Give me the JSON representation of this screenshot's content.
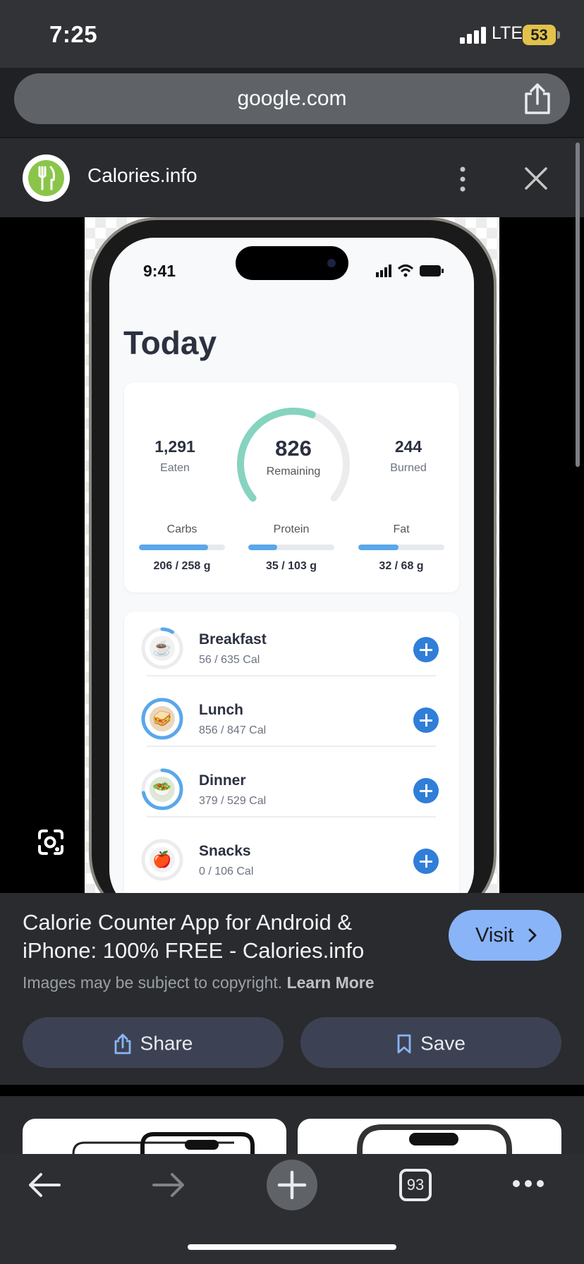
{
  "status_bar": {
    "time": "7:25",
    "network": "LTE",
    "battery": "53"
  },
  "browser": {
    "url": "google.com"
  },
  "site_header": {
    "site_name": "Calories.info"
  },
  "preview": {
    "phone_time": "9:41",
    "page_title": "Today",
    "summary": {
      "eaten": {
        "value": "1,291",
        "label": "Eaten"
      },
      "remaining": {
        "value": "826",
        "label": "Remaining",
        "progress": 0.58
      },
      "burned": {
        "value": "244",
        "label": "Burned"
      }
    },
    "macros": [
      {
        "label": "Carbs",
        "value": "206 / 258 g",
        "progress": 0.8
      },
      {
        "label": "Protein",
        "value": "35 / 103 g",
        "progress": 0.34
      },
      {
        "label": "Fat",
        "value": "32 / 68 g",
        "progress": 0.47
      }
    ],
    "meals": [
      {
        "name": "Breakfast",
        "cal": "56 / 635 Cal",
        "icon": "coffee-icon",
        "glyph": "☕",
        "progress": 0.09
      },
      {
        "name": "Lunch",
        "cal": "856 / 847 Cal",
        "icon": "sandwich-icon",
        "glyph": "🥪",
        "progress": 1.0
      },
      {
        "name": "Dinner",
        "cal": "379 / 529 Cal",
        "icon": "salad-icon",
        "glyph": "🥗",
        "progress": 0.72
      },
      {
        "name": "Snacks",
        "cal": "0 / 106 Cal",
        "icon": "apple-icon",
        "glyph": "🍎",
        "progress": 0
      }
    ]
  },
  "result_info": {
    "title": "Calorie Counter App for Android & iPhone: 100% FREE - Calories.info",
    "visit_label": "Visit",
    "copyright_text": "Images may be subject to copyright.",
    "learn_more": "Learn More",
    "share_label": "Share",
    "save_label": "Save"
  },
  "bottom_bar": {
    "tab_count": "93"
  },
  "colors": {
    "accent_blue": "#8ab4f8",
    "gauge_teal": "#86d3c0",
    "macro_blue": "#5aa7ea",
    "plus_blue": "#2f7ed8",
    "logo_green": "#8ac54a"
  }
}
